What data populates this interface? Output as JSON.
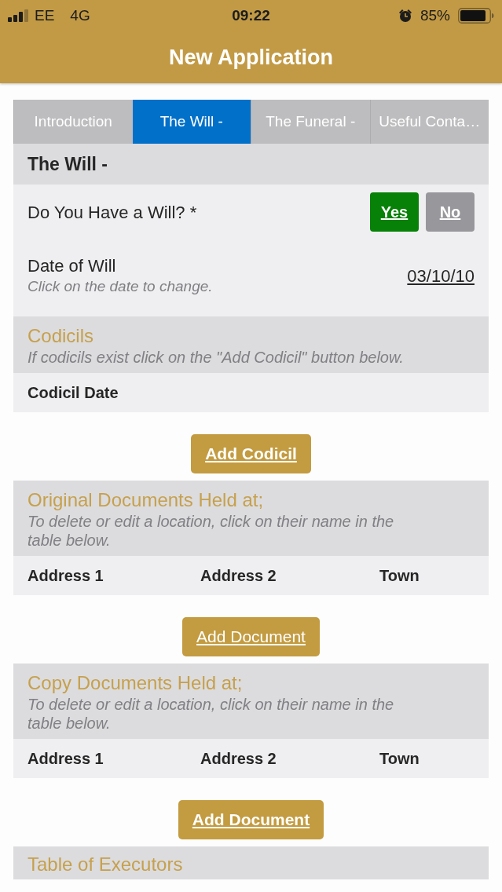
{
  "status_bar": {
    "carrier": "EE",
    "network": "4G",
    "time": "09:22",
    "battery": "85%"
  },
  "header": {
    "title": "New Application"
  },
  "tabs": [
    {
      "label": "Introduction",
      "selected": false
    },
    {
      "label": "The Will -",
      "selected": true
    },
    {
      "label": "The Funeral -",
      "selected": false
    },
    {
      "label": "Useful Conta…",
      "selected": false
    }
  ],
  "form": [
    {
      "kind": "heading",
      "title": "The Will -"
    },
    {
      "kind": "choice",
      "label": "Do You Have a Will? *",
      "options": [
        {
          "label": "Yes",
          "selected": true
        },
        {
          "label": "No",
          "selected": false
        }
      ]
    },
    {
      "kind": "date",
      "label": "Date of Will",
      "hint": "Click on the date to change.",
      "value": "03/10/10"
    },
    {
      "kind": "group",
      "title": "Codicils",
      "hint": "If codicils exist click on the \"Add Codicil\" button below.",
      "columns": [
        "Codicil Date"
      ],
      "button": {
        "label": "Add Codicil",
        "bold": true
      }
    },
    {
      "kind": "group",
      "title": "Original Documents Held at;",
      "hint": "To delete or edit a location, click on their name in the table below.",
      "columns": [
        "Address 1",
        "Address 2",
        "Town"
      ],
      "button": {
        "label": "Add Document",
        "bold": false
      }
    },
    {
      "kind": "group",
      "title": "Copy Documents Held at;",
      "hint": "To delete or edit a location, click on their name in the table below.",
      "columns": [
        "Address 1",
        "Address 2",
        "Town"
      ],
      "button": {
        "label": "Add Document",
        "bold": true
      }
    },
    {
      "kind": "group",
      "title": "Table of Executors"
    }
  ]
}
